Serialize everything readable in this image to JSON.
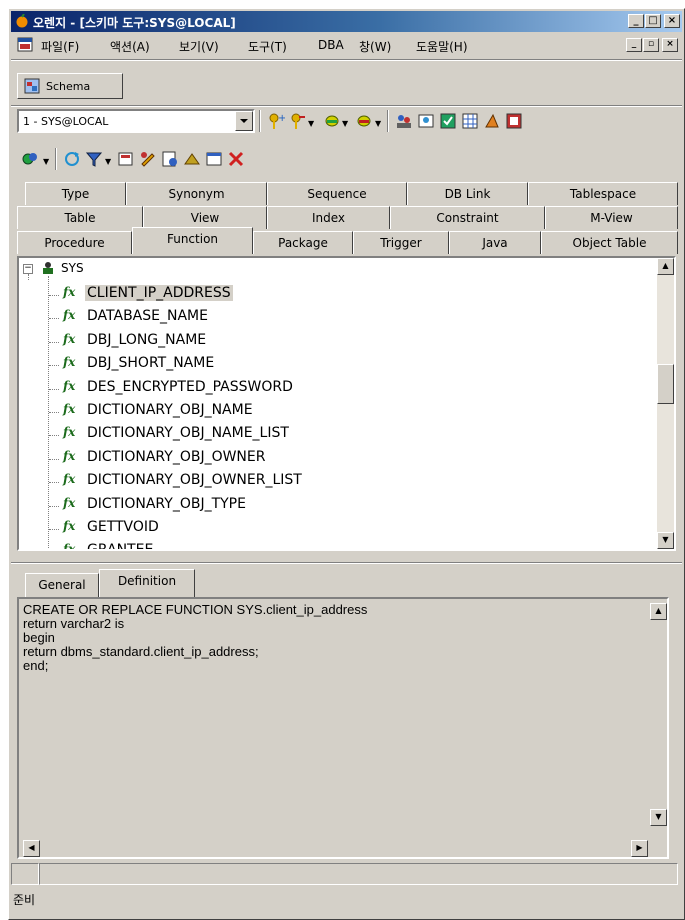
{
  "window": {
    "title": "오렌지 - [스키마 도구:SYS@LOCAL]",
    "buttons": {
      "minimize": "_",
      "maximize": "□",
      "close": "×"
    }
  },
  "menu": {
    "items": [
      "파일(F)",
      "액션(A)",
      "보기(V)",
      "도구(T)",
      "DBA",
      "창(W)",
      "도움말(H)"
    ],
    "mdi_buttons": {
      "minimize": "_",
      "restore": "▫",
      "close": "×"
    }
  },
  "schema_tab": {
    "label": "Schema"
  },
  "connection": {
    "value": "1 - SYS@LOCAL"
  },
  "object_tabs": {
    "row1": [
      "Type",
      "Synonym",
      "Sequence",
      "DB Link",
      "Tablespace"
    ],
    "row2": [
      "Table",
      "View",
      "Index",
      "Constraint",
      "M-View"
    ],
    "row3": [
      "Procedure",
      "Function",
      "Package",
      "Trigger",
      "Java",
      "Object Table"
    ],
    "active": "Function"
  },
  "tree": {
    "schema": "SYS",
    "expander": "−",
    "icon_glyph": "fx",
    "functions": [
      "CLIENT_IP_ADDRESS",
      "DATABASE_NAME",
      "DBJ_LONG_NAME",
      "DBJ_SHORT_NAME",
      "DES_ENCRYPTED_PASSWORD",
      "DICTIONARY_OBJ_NAME",
      "DICTIONARY_OBJ_NAME_LIST",
      "DICTIONARY_OBJ_OWNER",
      "DICTIONARY_OBJ_OWNER_LIST",
      "DICTIONARY_OBJ_TYPE",
      "GETTVOID",
      "GRANTEE"
    ],
    "selected_index": 0
  },
  "detail_tabs": {
    "general": "General",
    "definition": "Definition",
    "active": "Definition"
  },
  "definition": {
    "code": "CREATE OR REPLACE FUNCTION SYS.client_ip_address\nreturn varchar2 is\nbegin\nreturn dbms_standard.client_ip_address;\nend;"
  },
  "status": {
    "text": "준비"
  },
  "colors": {
    "title_start": "#0a246a",
    "title_end": "#a6caf0",
    "face": "#d4d0c8",
    "function_icon": "#1c6b1c"
  }
}
